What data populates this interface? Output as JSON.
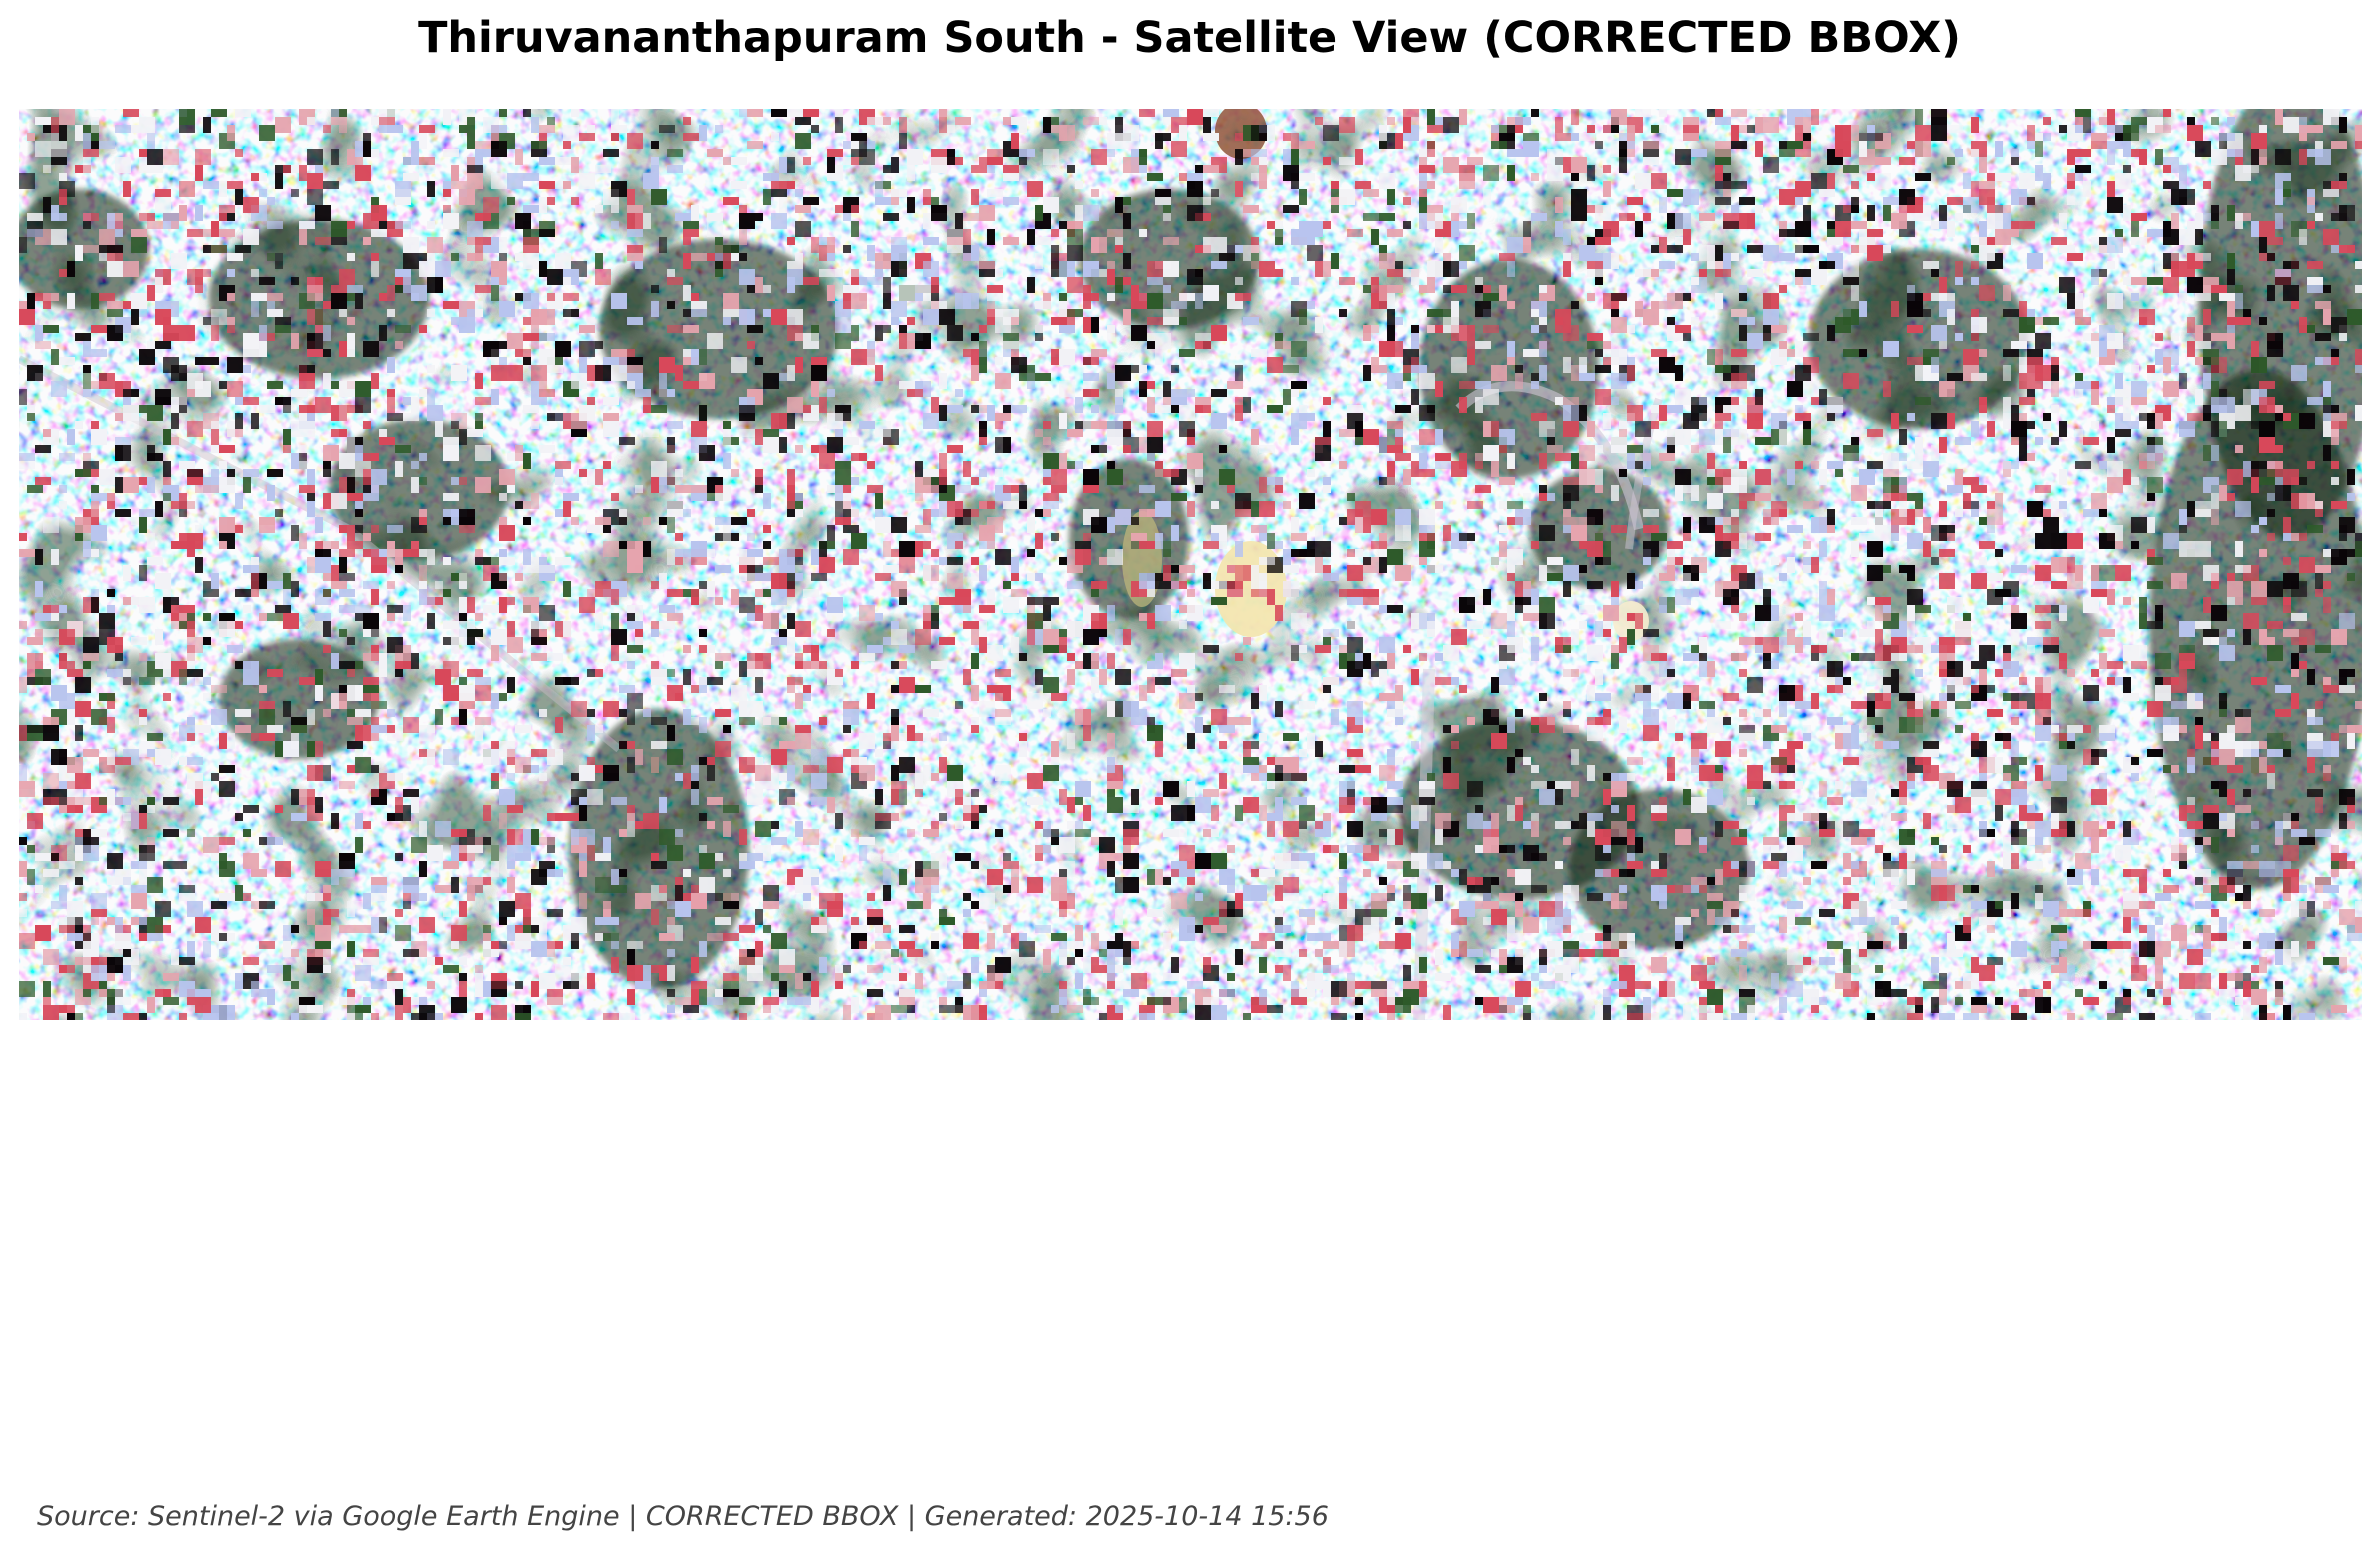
{
  "figure": {
    "title": "Thiruvananthapuram South - Satellite View (CORRECTED BBOX)",
    "footer": "Source: Sentinel-2 via Google Earth Engine | CORRECTED BBOX | Generated: 2025-10-14 15:56"
  },
  "imagery": {
    "colors": {
      "urban_light": "#f2f2f6",
      "urban_blue": "#b8c4ee",
      "roof_red": "#d8485a",
      "roof_pink": "#e6a4ae",
      "vegetation_dark": "#102010",
      "vegetation_green": "#2e5a2a",
      "shadow": "#0a0508",
      "sand": "#f3e6b0",
      "brown": "#8a4a2e"
    }
  }
}
